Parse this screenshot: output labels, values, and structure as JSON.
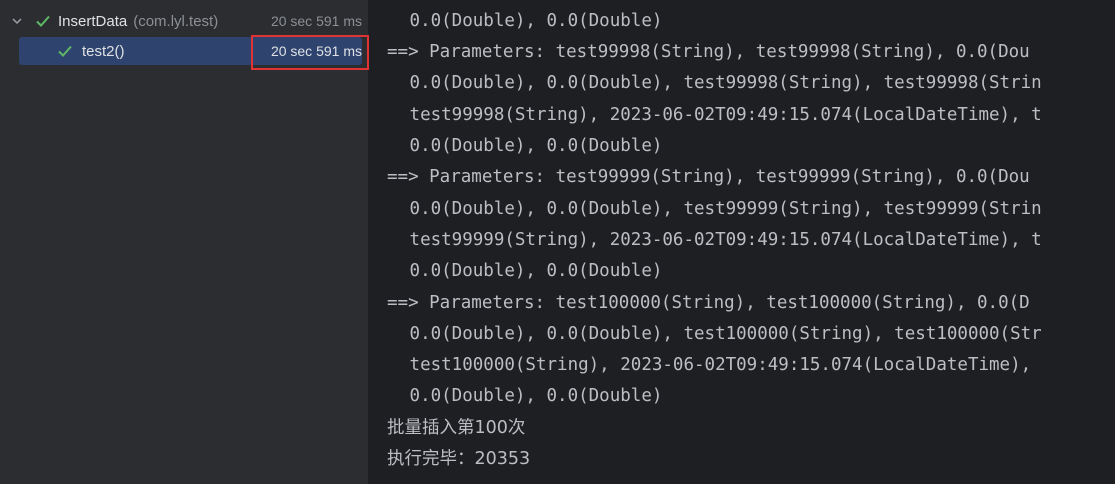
{
  "tree": {
    "suite": {
      "name": "InsertData",
      "package": "(com.lyl.test)",
      "duration": "20 sec 591 ms"
    },
    "test": {
      "name": "test2()",
      "duration": "20 sec 591 ms"
    }
  },
  "console": {
    "lines": [
      " 0.0(Double), 0.0(Double)",
      "==> Parameters: test99998(String), test99998(String), 0.0(Dou",
      " 0.0(Double), 0.0(Double), test99998(String), test99998(Strin",
      " test99998(String), 2023-06-02T09:49:15.074(LocalDateTime), t",
      " 0.0(Double), 0.0(Double)",
      "==> Parameters: test99999(String), test99999(String), 0.0(Dou",
      " 0.0(Double), 0.0(Double), test99999(String), test99999(Strin",
      " test99999(String), 2023-06-02T09:49:15.074(LocalDateTime), t",
      " 0.0(Double), 0.0(Double)",
      "==> Parameters: test100000(String), test100000(String), 0.0(D",
      " 0.0(Double), 0.0(Double), test100000(String), test100000(Str",
      " test100000(String), 2023-06-02T09:49:15.074(LocalDateTime), ",
      " 0.0(Double), 0.0(Double)",
      "批量插入第100次",
      "执行完毕：20353"
    ]
  },
  "colors": {
    "pass_green": "#5fb865",
    "selection": "#2e436e",
    "highlight_red": "#e03434"
  }
}
